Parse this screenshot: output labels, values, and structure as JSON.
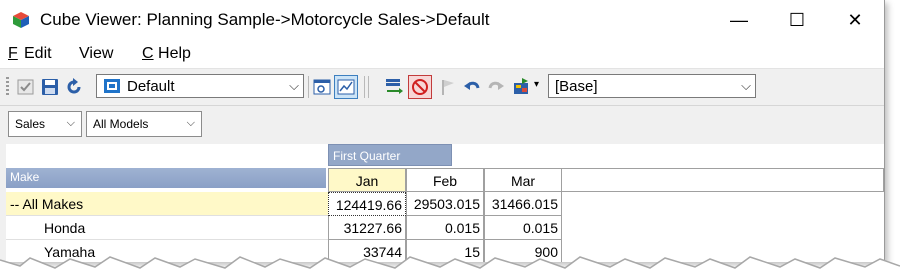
{
  "window": {
    "title": "Cube Viewer: Planning Sample->Motorcycle Sales->Default",
    "controls": {
      "minimize": "—",
      "maximize": "☐",
      "close": "✕"
    }
  },
  "menu": {
    "file": {
      "accel": "F",
      "label": "",
      "suffix": ""
    },
    "edit": {
      "label": "Edit"
    },
    "view": {
      "label": "View"
    },
    "help": {
      "accel": "C",
      "label": "Help"
    }
  },
  "toolbar": {
    "view_select": {
      "value": "Default"
    },
    "scenario_select": {
      "value": "[Base]"
    }
  },
  "filters": {
    "sales": "Sales",
    "models": "All Models"
  },
  "grid": {
    "column_group": "First Quarter",
    "row_header": "Make",
    "columns": [
      "Jan",
      "Feb",
      "Mar"
    ],
    "rows": [
      {
        "label": "-- All Makes",
        "values": [
          "124419.66",
          "29503.015",
          "31466.015"
        ]
      },
      {
        "label": "Honda",
        "values": [
          "31227.66",
          "0.015",
          "0.015"
        ]
      },
      {
        "label": "Yamaha",
        "values": [
          "33744",
          "15",
          "900"
        ]
      }
    ]
  }
}
